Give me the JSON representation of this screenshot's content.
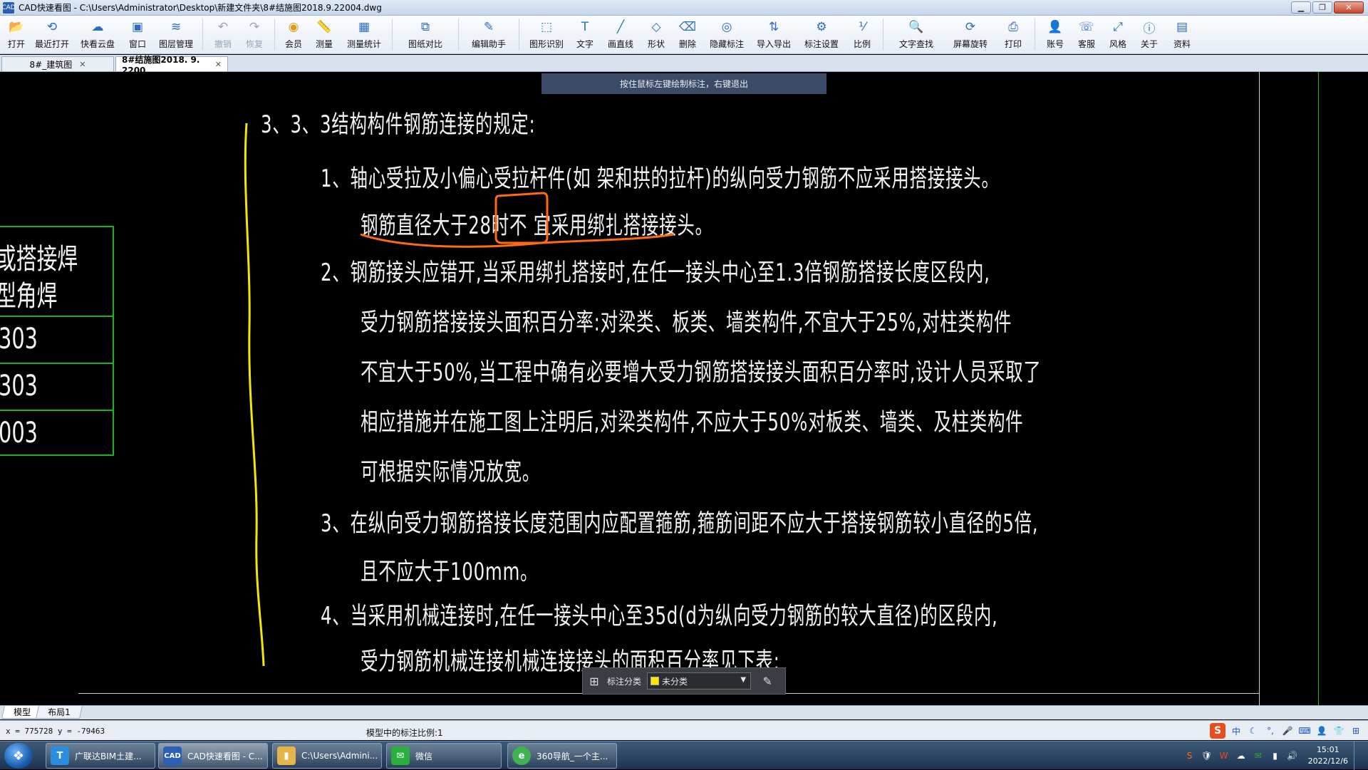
{
  "window": {
    "title": "CAD快速看图 - C:\\Users\\Administrator\\Desktop\\新建文件夹\\8#结施图2018.9.22004.dwg",
    "app_icon_text": "CAD"
  },
  "toolbar": {
    "items": [
      {
        "label": "打开",
        "icon": "folder-icon",
        "glyph": "📂"
      },
      {
        "label": "最近打开",
        "icon": "history-icon",
        "glyph": "⟲"
      },
      {
        "label": "快看云盘",
        "icon": "cloud-icon",
        "glyph": "☁"
      },
      {
        "label": "窗口",
        "icon": "window-icon",
        "glyph": "▣"
      },
      {
        "label": "图层管理",
        "icon": "layers-icon",
        "glyph": "≋"
      },
      {
        "label": "撤销",
        "icon": "undo-icon",
        "glyph": "↶",
        "disabled": true
      },
      {
        "label": "恢复",
        "icon": "redo-icon",
        "glyph": "↷",
        "disabled": true
      },
      {
        "label": "会员",
        "icon": "vip-icon",
        "glyph": "◉",
        "vip": true
      },
      {
        "label": "测量",
        "icon": "ruler-icon",
        "glyph": "📏"
      },
      {
        "label": "测量统计",
        "icon": "measure-stats-icon",
        "glyph": "▦"
      },
      {
        "label": "图纸对比",
        "icon": "compare-icon",
        "glyph": "⧉"
      },
      {
        "label": "编辑助手",
        "icon": "edit-helper-icon",
        "glyph": "✎"
      },
      {
        "label": "图形识别",
        "icon": "shape-recognize-icon",
        "glyph": "⬚"
      },
      {
        "label": "文字",
        "icon": "text-icon",
        "glyph": "T"
      },
      {
        "label": "画直线",
        "icon": "line-icon",
        "glyph": "╱"
      },
      {
        "label": "形状",
        "icon": "shape-icon",
        "glyph": "◇"
      },
      {
        "label": "删除",
        "icon": "eraser-icon",
        "glyph": "⌫"
      },
      {
        "label": "隐藏标注",
        "icon": "eye-hide-icon",
        "glyph": "◎"
      },
      {
        "label": "导入导出",
        "icon": "import-export-icon",
        "glyph": "⇅"
      },
      {
        "label": "标注设置",
        "icon": "annot-settings-icon",
        "glyph": "⚙"
      },
      {
        "label": "比例",
        "icon": "scale-icon",
        "glyph": "⅟"
      },
      {
        "label": "文字查找",
        "icon": "text-search-icon",
        "glyph": "🔍"
      },
      {
        "label": "屏幕旋转",
        "icon": "rotate-icon",
        "glyph": "⟳"
      },
      {
        "label": "打印",
        "icon": "print-icon",
        "glyph": "⎙"
      },
      {
        "label": "账号",
        "icon": "user-icon",
        "glyph": "👤"
      },
      {
        "label": "客服",
        "icon": "headset-icon",
        "glyph": "☏"
      },
      {
        "label": "风格",
        "icon": "style-icon",
        "glyph": "⤢"
      },
      {
        "label": "关于",
        "icon": "info-icon",
        "glyph": "ⓘ"
      },
      {
        "label": "资料",
        "icon": "docs-icon",
        "glyph": "▤"
      }
    ]
  },
  "doc_tabs": [
    {
      "label": "8#_建筑图",
      "active": false
    },
    {
      "label": "8#结施图2018. 9. 2200",
      "active": true
    }
  ],
  "hint": "按住鼠标左键绘制标注，右键退出",
  "drawing": {
    "heading": "3、3、3结构构件钢筋连接的规定:",
    "lines": [
      "1、轴心受拉及小偏心受拉杆件(如  架和拱的拉杆)的纵向受力钢筋不应采用搭接接头。",
      "钢筋直径大于28时不  宜采用绑扎搭接接头。",
      "2、钢筋接头应错开,当采用绑扎搭接时,在任一接头中心至1.3倍钢筋搭接长度区段内,",
      "受力钢筋搭接接头面积百分率:对梁类、板类、墙类构件,不宜大于25%,对柱类构件",
      "不宜大于50%,当工程中确有必要增大受力钢筋搭接接头面积百分率时,设计人员采取了",
      "相应措施并在施工图上注明后,对梁类构件,不应大于50%对板类、墙类、及柱类构件",
      "可根据实际情况放宽。",
      "3、在纵向受力钢筋搭接长度范围内应配置箍筋,箍筋间距不应大于搭接钢筋较小直径的5倍,",
      "且不应大于100mm。",
      "4、当采用机械连接时,在任一接头中心至35d(d为纵向受力钢筋的较大直径)的区段内,",
      "受力钢筋机械连接机械连接接头的面积百分率见下表:"
    ],
    "left_table": {
      "header_lines": [
        "或搭接焊",
        "型角焊"
      ],
      "rows": [
        "303",
        "303",
        "003"
      ]
    },
    "colors": {
      "markup_orange": "#ff6a13",
      "bracket_yellow": "#f5e600",
      "table_green": "#19b419"
    }
  },
  "annotation_bar": {
    "label": "标注分类",
    "selected": "未分类",
    "swatch_color": "#ffe600"
  },
  "layout_tabs": [
    {
      "label": "模型",
      "active": true
    },
    {
      "label": "布局1",
      "active": false
    }
  ],
  "status": {
    "coords": "x = 775728  y = -79463",
    "scale": "模型中的标注比例:1"
  },
  "taskbar": {
    "tasks": [
      {
        "label": "广联达BIM土建...",
        "icon_text": "T",
        "color": "#2a8de0"
      },
      {
        "label": "CAD快速看图 - C...",
        "icon_text": "CAD",
        "color": "#2b5fb5",
        "active": true
      },
      {
        "label": "C:\\Users\\Admini...",
        "icon_text": "▮",
        "color": "#e3b54a"
      },
      {
        "label": "微信",
        "icon_text": "✉",
        "color": "#2aae3c"
      },
      {
        "label": "360导航_一个主...",
        "icon_text": "e",
        "color": "#3fb34f"
      }
    ],
    "time": "15:01",
    "date": "2022/12/6"
  },
  "ime": {
    "mode": "中"
  }
}
